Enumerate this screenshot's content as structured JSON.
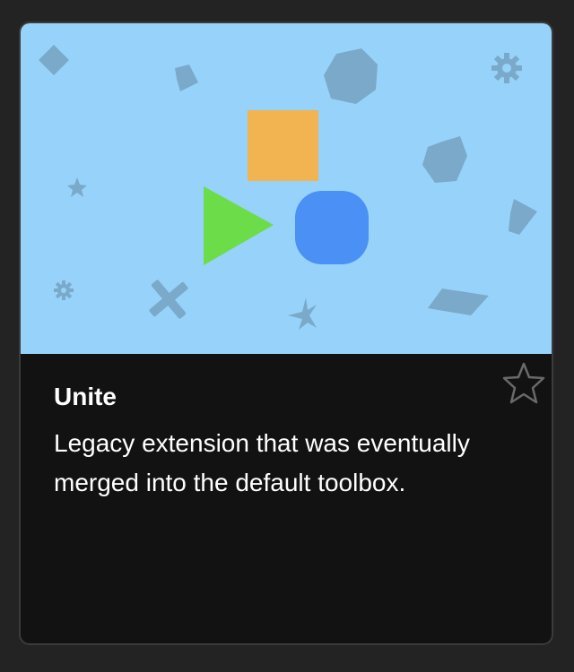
{
  "extension": {
    "title": "Unite",
    "description": "Legacy extension that was eventually merged into the default toolbox.",
    "favorited": false
  },
  "icons": {
    "favorite": "star-outline-icon",
    "thumbnail_shapes": [
      "orange-square",
      "green-triangle",
      "blue-rounded-square"
    ]
  },
  "colors": {
    "page_background": "#232323",
    "card_background": "#121212",
    "thumbnail_background": "#97d2fa",
    "decoration": "#7aa9c9",
    "square": "#f1b451",
    "triangle": "#6cdc48",
    "circle": "#4a90f5",
    "text": "#ffffff"
  }
}
